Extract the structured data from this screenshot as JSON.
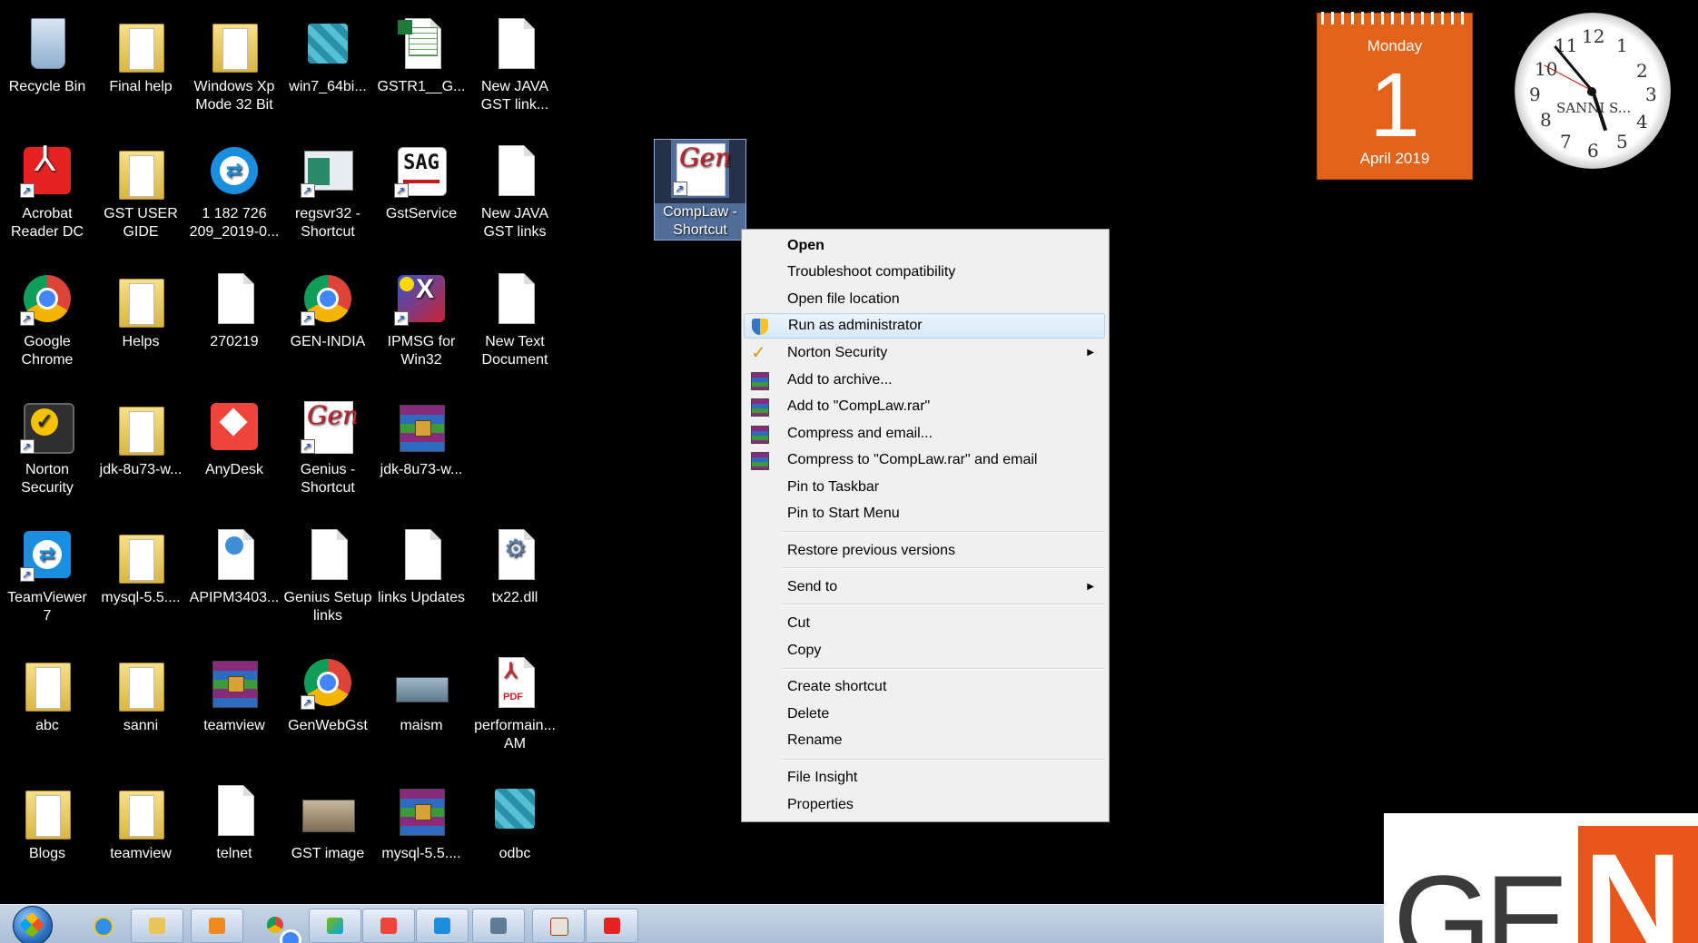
{
  "desktop": {
    "icons": [
      {
        "label": "Recycle Bin"
      },
      {
        "label": "Final help"
      },
      {
        "label": "Windows Xp Mode 32 Bit"
      },
      {
        "label": "win7_64bi..."
      },
      {
        "label": "GSTR1__G..."
      },
      {
        "label": "New JAVA GST link..."
      },
      {
        "label": "Acrobat Reader DC"
      },
      {
        "label": "GST USER GIDE"
      },
      {
        "label": "1 182 726 209_2019-0..."
      },
      {
        "label": "regsvr32 - Shortcut"
      },
      {
        "label": "GstService"
      },
      {
        "label": "New JAVA GST links"
      },
      {
        "label": "Google Chrome"
      },
      {
        "label": "Helps"
      },
      {
        "label": "270219"
      },
      {
        "label": "GEN-INDIA"
      },
      {
        "label": "IPMSG for Win32"
      },
      {
        "label": "New Text Document"
      },
      {
        "label": "Norton Security"
      },
      {
        "label": "jdk-8u73-w..."
      },
      {
        "label": "AnyDesk"
      },
      {
        "label": "Genius - Shortcut"
      },
      {
        "label": "jdk-8u73-w..."
      },
      {
        "label": "TeamViewer 7"
      },
      {
        "label": "mysql-5.5...."
      },
      {
        "label": "APIPM3403..."
      },
      {
        "label": "Genius Setup links"
      },
      {
        "label": "links Updates"
      },
      {
        "label": "tx22.dll"
      },
      {
        "label": "abc"
      },
      {
        "label": "sanni"
      },
      {
        "label": "teamview"
      },
      {
        "label": "GenWebGst"
      },
      {
        "label": "maism"
      },
      {
        "label": "performain... AM"
      },
      {
        "label": "Blogs"
      },
      {
        "label": "teamview"
      },
      {
        "label": "telnet"
      },
      {
        "label": "GST image"
      },
      {
        "label": "mysql-5.5...."
      },
      {
        "label": "odbc"
      },
      {
        "label": "CompLaw - Shortcut"
      }
    ],
    "sag_text": "SAG",
    "genius_text": "Gen"
  },
  "calendar": {
    "day": "Monday",
    "date": "1",
    "month_year": "April 2019",
    "color": "#e3631a"
  },
  "clock": {
    "numbers": [
      "12",
      "1",
      "2",
      "3",
      "4",
      "5",
      "6",
      "7",
      "8",
      "9",
      "10",
      "11"
    ],
    "brand": "SANNI S..."
  },
  "context_menu": {
    "items": [
      {
        "label": "Open"
      },
      {
        "label": "Troubleshoot compatibility"
      },
      {
        "label": "Open file location"
      },
      {
        "label": "Run as administrator"
      },
      {
        "label": "Norton Security"
      },
      {
        "label": "Add to archive..."
      },
      {
        "label": "Add to \"CompLaw.rar\""
      },
      {
        "label": "Compress and email..."
      },
      {
        "label": "Compress to \"CompLaw.rar\" and email"
      },
      {
        "label": "Pin to Taskbar"
      },
      {
        "label": "Pin to Start Menu"
      },
      {
        "label": "Restore previous versions"
      },
      {
        "label": "Send to"
      },
      {
        "label": "Cut"
      },
      {
        "label": "Copy"
      },
      {
        "label": "Create shortcut"
      },
      {
        "label": "Delete"
      },
      {
        "label": "Rename"
      },
      {
        "label": "File Insight"
      },
      {
        "label": "Properties"
      }
    ],
    "highlight_color": "#d9e9f8"
  },
  "taskbar": {
    "apps": [
      "internet-explorer",
      "windows-explorer",
      "media-player",
      "google-chrome",
      "windows-xp-mode",
      "anydesk",
      "teamviewer",
      "system-window",
      "java",
      "acrobat"
    ]
  },
  "logo": {
    "left_text": "GE",
    "right_text": "N",
    "accent": "#e8561a"
  }
}
